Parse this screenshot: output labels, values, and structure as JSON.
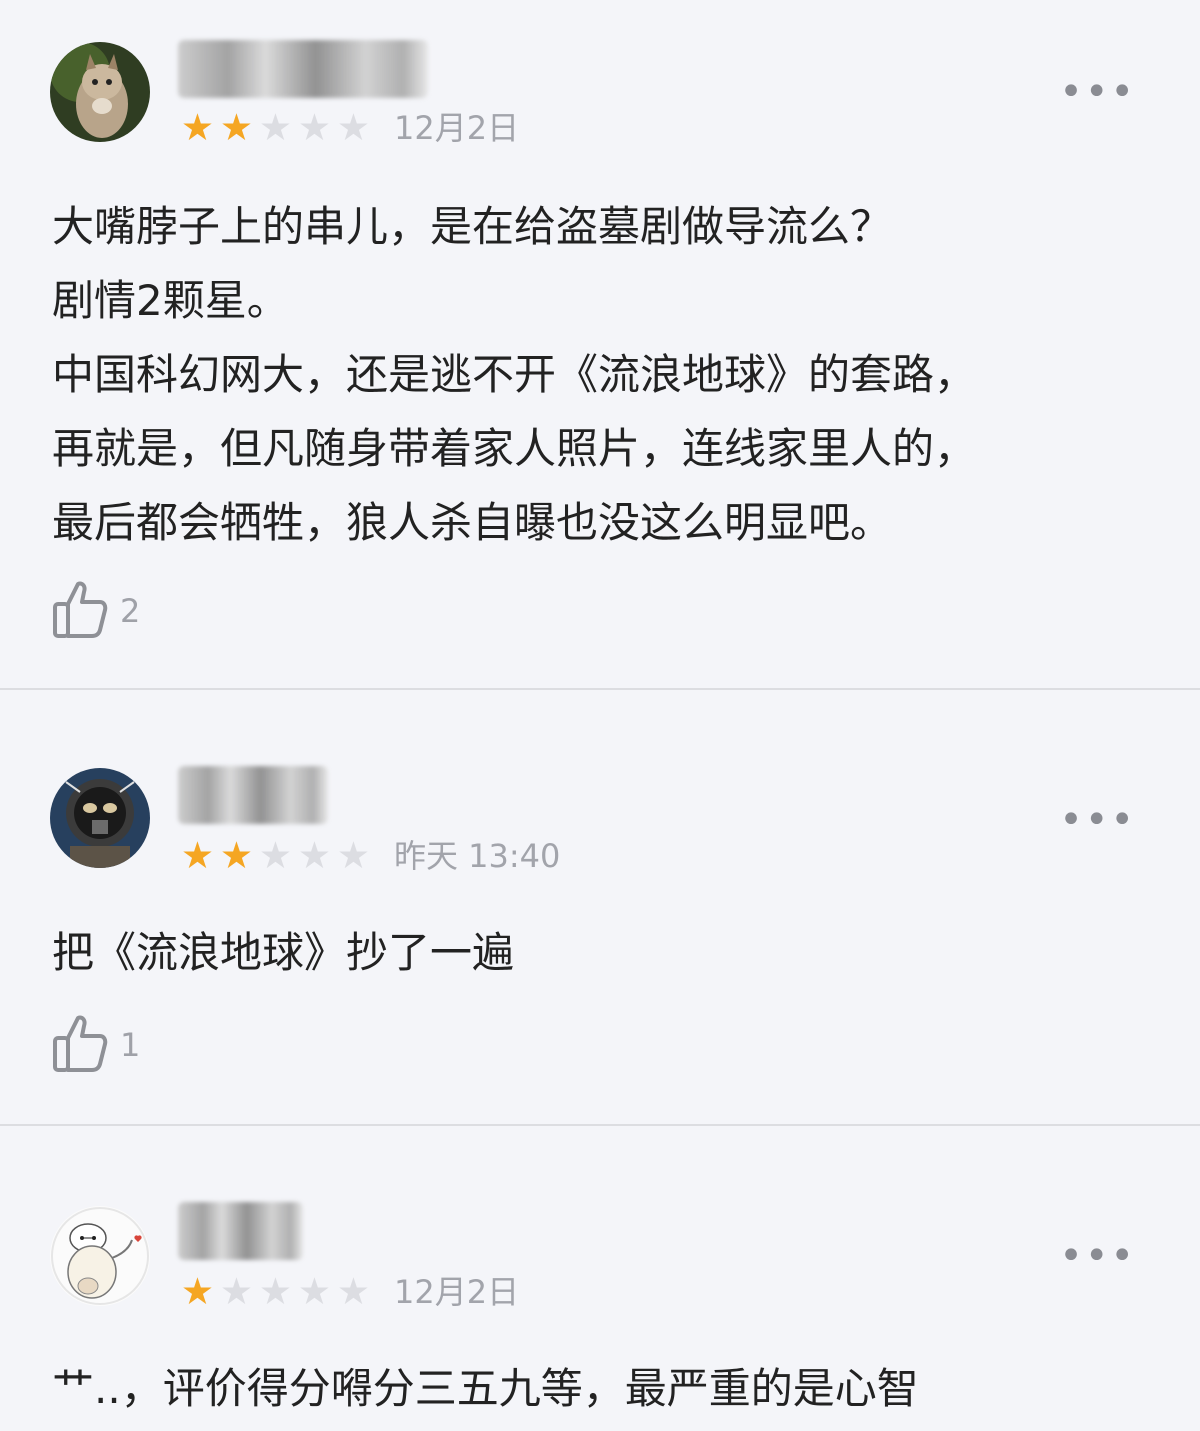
{
  "reviews": [
    {
      "stars_filled": 2,
      "stars_total": 5,
      "date": "12月2日",
      "more": "•••",
      "text_lines": [
        "大嘴脖子上的串儿，是在给盗墓剧做导流么？",
        "剧情2颗星。",
        "中国科幻网大，还是逃不开《流浪地球》的套路，",
        "再就是，但凡随身带着家人照片，连线家里人的，",
        "最后都会牺牲，狼人杀自曝也没这么明显吧。"
      ],
      "likes": "2",
      "avatar_icon": "kitten-avatar"
    },
    {
      "stars_filled": 2,
      "stars_total": 5,
      "date": "昨天 13:40",
      "more": "•••",
      "text_lines": [
        "把《流浪地球》抄了一遍"
      ],
      "likes": "1",
      "avatar_icon": "astronaut-avatar"
    },
    {
      "stars_filled": 1,
      "stars_total": 5,
      "date": "12月2日",
      "more": "•••",
      "text_lines": [
        "艹..，评价得分嘚分三五九等，最严重的是心智"
      ],
      "likes": "",
      "avatar_icon": "cartoon-avatar"
    }
  ],
  "colors": {
    "star_on": "#f5a623",
    "star_off": "#dcdde2",
    "background": "#f4f5f9"
  }
}
